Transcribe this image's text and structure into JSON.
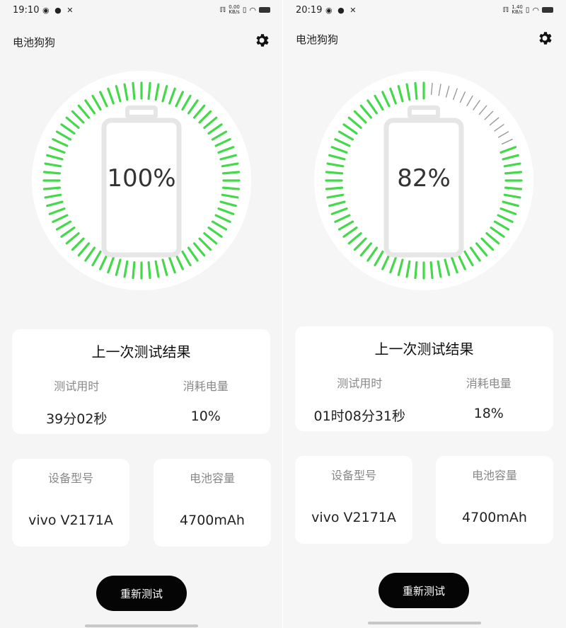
{
  "screens": [
    {
      "status": {
        "time": "19:10",
        "net_rate": "0.00",
        "net_unit": "KB/s"
      },
      "app_title": "电池狗狗",
      "battery_percent_label": "100%",
      "battery_level": 100,
      "last_result": {
        "title": "上一次测试结果",
        "duration_label": "测试用时",
        "duration_value": "39分02秒",
        "consumed_label": "消耗电量",
        "consumed_value": "10%"
      },
      "device": {
        "label": "设备型号",
        "value": "vivo  V2171A"
      },
      "capacity": {
        "label": "电池容量",
        "value": "4700mAh"
      },
      "retest_button": "重新测试"
    },
    {
      "status": {
        "time": "20:19",
        "net_rate": "1.40",
        "net_unit": "KB/s"
      },
      "app_title": "电池狗狗",
      "battery_percent_label": "82%",
      "battery_level": 82,
      "last_result": {
        "title": "上一次测试结果",
        "duration_label": "测试用时",
        "duration_value": "01时08分31秒",
        "consumed_label": "消耗电量",
        "consumed_value": "18%"
      },
      "device": {
        "label": "设备型号",
        "value": "vivo  V2171A"
      },
      "capacity": {
        "label": "电池容量",
        "value": "4700mAh"
      },
      "retest_button": "重新测试"
    }
  ],
  "colors": {
    "tick_active": "#44d84a",
    "tick_inactive": "#9a9a9a",
    "button_bg": "#050505"
  },
  "icons": {
    "settings": "gear-icon",
    "wifi": "wifi-icon",
    "battery": "battery-icon"
  }
}
